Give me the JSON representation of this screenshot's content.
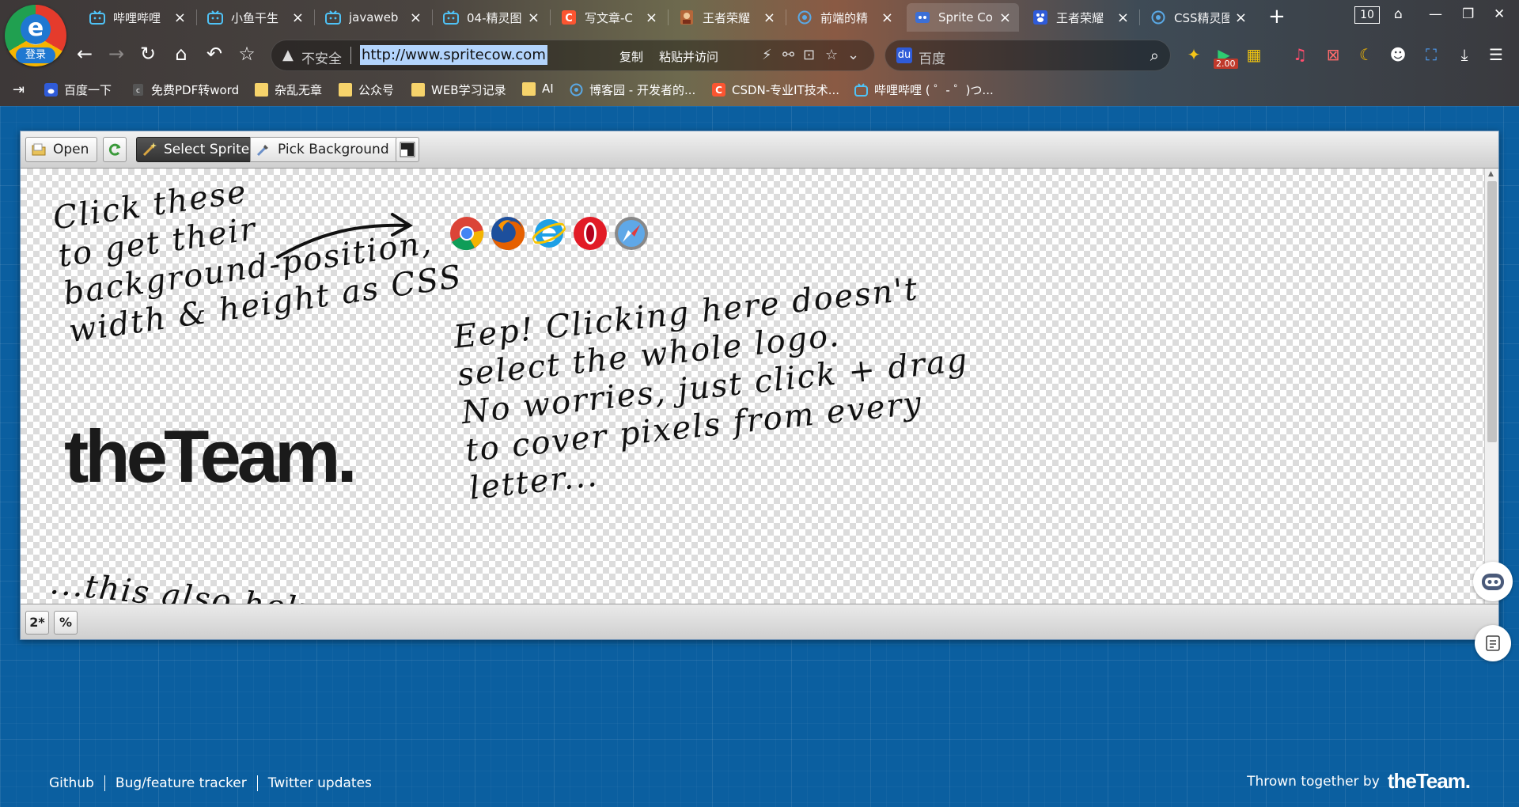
{
  "browser": {
    "login_label": "登录",
    "tabs": [
      {
        "label": "哔哩哔哩",
        "icon": "bilibili-icon",
        "active": false
      },
      {
        "label": "小鱼干生",
        "icon": "bilibili-icon",
        "active": false
      },
      {
        "label": "javaweb",
        "icon": "bilibili-icon",
        "active": false
      },
      {
        "label": "04-精灵图",
        "icon": "bilibili-icon",
        "active": false
      },
      {
        "label": "写文章-C",
        "icon": "csdn-icon",
        "active": false
      },
      {
        "label": "王者荣耀",
        "icon": "game-icon",
        "active": false
      },
      {
        "label": "前端的精",
        "icon": "blog-icon",
        "active": false
      },
      {
        "label": "Sprite Co",
        "icon": "spritecow-icon",
        "active": true
      },
      {
        "label": "王者荣耀",
        "icon": "baidu-icon",
        "active": false
      },
      {
        "label": "CSS精灵图",
        "icon": "blog-icon",
        "active": false
      }
    ],
    "tab_count": "10",
    "address": {
      "insecure_label": "不安全",
      "url": "http://www.spritecow.com",
      "copy_label": "复制",
      "paste_visit_label": "粘贴并访问"
    },
    "search": {
      "placeholder": "百度"
    },
    "speed_badge": "2.00",
    "bookmarks": [
      {
        "label": "百度一下",
        "icon": "baidu-icon"
      },
      {
        "label": "免费PDF转word",
        "icon": "pdf-icon"
      },
      {
        "label": "杂乱无章",
        "icon": "folder-icon"
      },
      {
        "label": "公众号",
        "icon": "folder-icon"
      },
      {
        "label": "WEB学习记录",
        "icon": "folder-icon"
      },
      {
        "label": "AI",
        "icon": "folder-icon"
      },
      {
        "label": "博客园 - 开发者的...",
        "icon": "blog-icon"
      },
      {
        "label": "CSDN-专业IT技术...",
        "icon": "csdn-icon"
      },
      {
        "label": "哔哩哔哩 ( ゜- ゜)つ...",
        "icon": "bilibili-icon"
      }
    ]
  },
  "app": {
    "toolbar": {
      "open_label": "Open",
      "select_sprite_label": "Select Sprite",
      "pick_background_label": "Pick Background"
    },
    "canvas": {
      "note1": [
        "Click these",
        "to get their",
        "background-position,",
        "width & height as CSS"
      ],
      "note2": [
        "Eep! Clicking here doesn't",
        "select the whole logo.",
        "No worries, just click + drag",
        "to cover pixels from every",
        "letter..."
      ],
      "note3": "...this also helps select",
      "logo_text": "theTeam."
    },
    "bottom": {
      "scale_label": "2*",
      "percent_label": "%"
    },
    "footer": {
      "links": [
        "Github",
        "Bug/feature tracker",
        "Twitter updates"
      ],
      "credit": "Thrown together by",
      "credit_logo": "theTeam."
    }
  }
}
